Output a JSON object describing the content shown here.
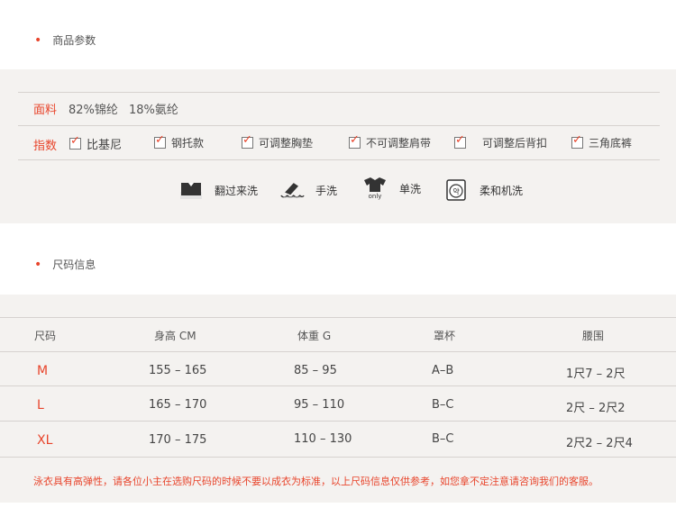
{
  "section1": {
    "title": "商品参数"
  },
  "params": {
    "material_label": "面料",
    "material_values": [
      "82%锦纶",
      "18%氨纶"
    ],
    "features_label": "指数",
    "features": [
      "比基尼",
      "钢托款",
      "可调整胸垫",
      "不可调整肩带",
      "可调整后背扣",
      "三角底裤"
    ],
    "care": [
      {
        "icon": "fold-wash-icon",
        "label": "翻过来洗"
      },
      {
        "icon": "hand-wash-icon",
        "label": "手洗"
      },
      {
        "icon": "wash-alone-icon",
        "label": "单洗",
        "icon_text": "only"
      },
      {
        "icon": "gentle-machine-icon",
        "label": "柔和机洗",
        "icon_text": "약"
      }
    ]
  },
  "section2": {
    "title": "尺码信息"
  },
  "size_table": {
    "headers": [
      "尺码",
      "身高  CM",
      "体重  G",
      "罩杯",
      "腰围"
    ],
    "rows": [
      [
        "M",
        "155 – 165",
        "85 – 95",
        "A–B",
        "1尺7 – 2尺"
      ],
      [
        "L",
        "165 – 170",
        "95 –  110",
        "B–C",
        "2尺 – 2尺2"
      ],
      [
        "XL",
        "170 – 175",
        "110  – 130",
        "B–C",
        "2尺2 – 2尺4"
      ]
    ],
    "note": "泳衣具有高弹性，请各位小主在选购尺码的时候不要以成衣为标准，以上尺码信息仅供参考，如您拿不定注意请咨询我们的客服。"
  },
  "colors": {
    "accent": "#e8452c",
    "band": "#f4f2f0",
    "line": "#d6d2cf"
  }
}
